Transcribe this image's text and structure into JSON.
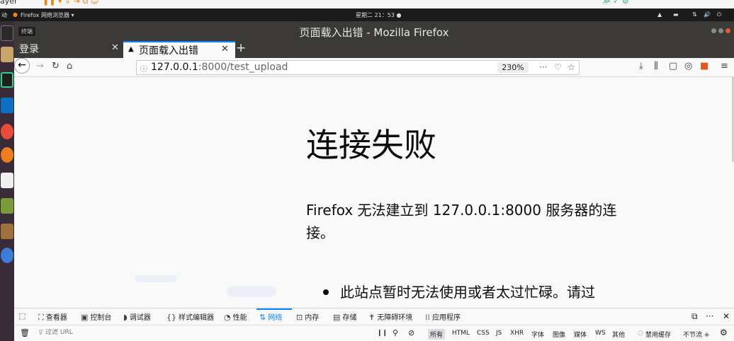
{
  "top_strip": {
    "left_fragment": "ayer",
    "right_symbols": "≫ ✓ ⚙"
  },
  "system_bar": {
    "activities": "动",
    "app_menu": "Firefox 网络浏览器 ▾",
    "clock": "星期二 21：53 ●",
    "tray_icons": [
      "▲",
      "▬",
      "⇅",
      "🔊",
      "⏻"
    ]
  },
  "launcher": {
    "items": [
      "terminal",
      "files",
      "pycharm",
      "vscode",
      "chrome",
      "firefox",
      "text-editor",
      "archive",
      "tool",
      "help"
    ]
  },
  "window": {
    "title": "页面载入出错 - Mozilla Firefox",
    "terminal_tooltip": "终端"
  },
  "tabs": [
    {
      "label": "登录",
      "active": false
    },
    {
      "label": "页面载入出错",
      "active": true
    }
  ],
  "navbar": {
    "url_host": "127.0.0.1",
    "url_rest": ":8000/test_upload",
    "zoom": "230%"
  },
  "page": {
    "title": "连接失败",
    "description": "Firefox 无法建立到 127.0.0.1:8000 服务器的连接。",
    "bullet": "此站点暂时无法使用或者太过忙碌。请过"
  },
  "devtools": {
    "tabs": [
      {
        "icon": "⛶",
        "label": "查看器"
      },
      {
        "icon": "▣",
        "label": "控制台"
      },
      {
        "icon": "◗",
        "label": "调试器"
      },
      {
        "icon": "{}",
        "label": "样式编辑器"
      },
      {
        "icon": "◔",
        "label": "性能"
      },
      {
        "icon": "⇅",
        "label": "网络"
      },
      {
        "icon": "⊡",
        "label": "内存"
      },
      {
        "icon": "▤",
        "label": "存储"
      },
      {
        "icon": "✝",
        "label": "无障碍环境"
      },
      {
        "icon": "⁞⁞",
        "label": "应用程序"
      }
    ],
    "active_tab": "网络",
    "filter_placeholder": "过滤 URL",
    "filter_types": [
      "所有",
      "HTML",
      "CSS",
      "JS",
      "XHR",
      "字体",
      "图像",
      "媒体",
      "WS",
      "其他"
    ],
    "disable_cache": "禁用缓存",
    "throttle": "不节流 ≑"
  }
}
